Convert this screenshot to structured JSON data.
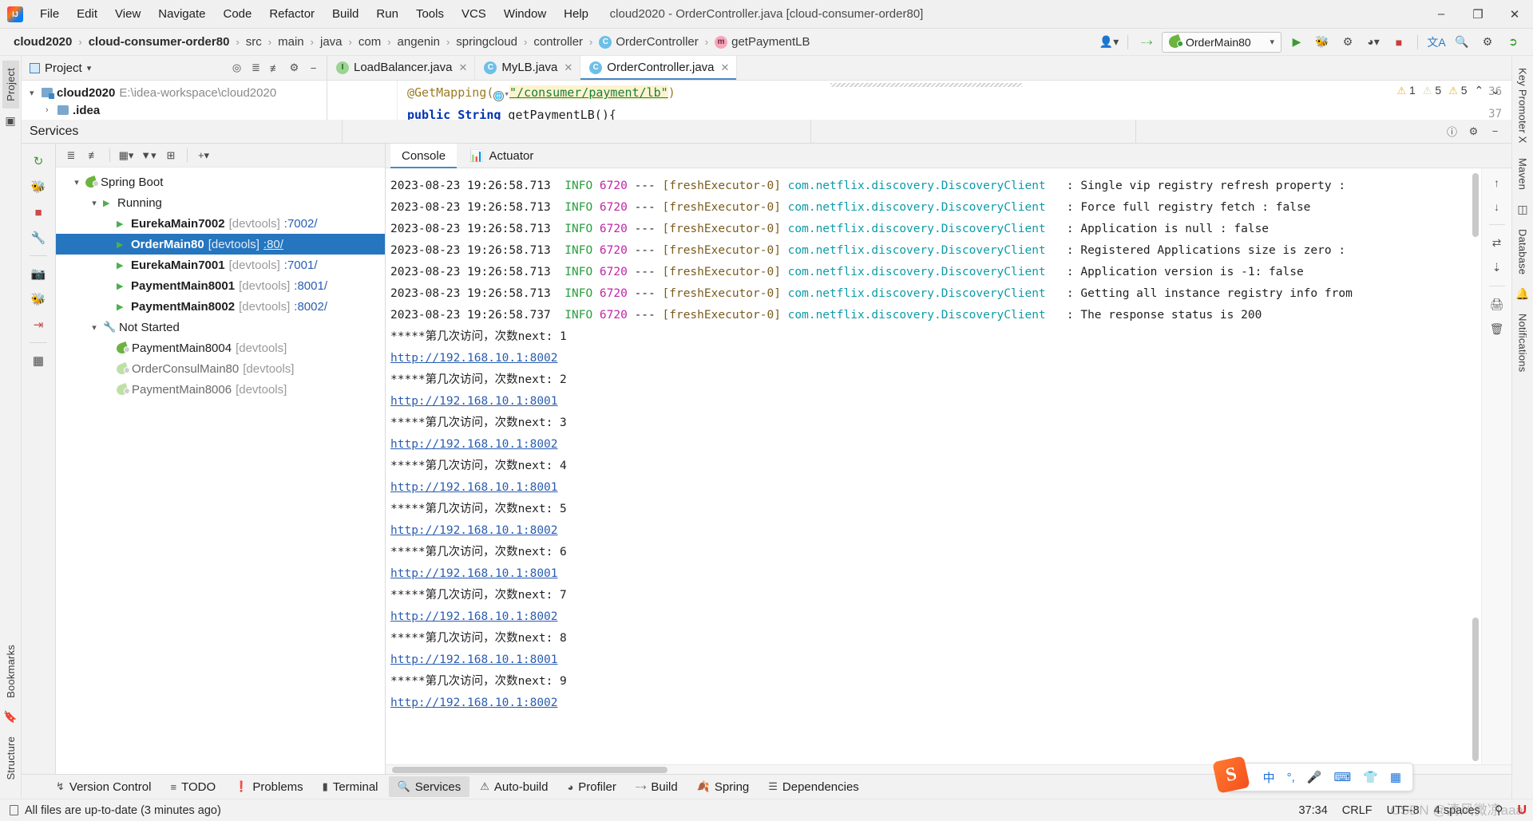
{
  "window": {
    "title": "cloud2020 - OrderController.java [cloud-consumer-order80]",
    "minimize": "–",
    "maximize": "❐",
    "close": "✕"
  },
  "menubar": {
    "items": [
      {
        "label": "File"
      },
      {
        "label": "Edit"
      },
      {
        "label": "View"
      },
      {
        "label": "Navigate"
      },
      {
        "label": "Code"
      },
      {
        "label": "Refactor"
      },
      {
        "label": "Build"
      },
      {
        "label": "Run"
      },
      {
        "label": "Tools"
      },
      {
        "label": "VCS"
      },
      {
        "label": "Window"
      },
      {
        "label": "Help"
      }
    ]
  },
  "breadcrumb": {
    "items": [
      {
        "label": "cloud2020",
        "bold": true
      },
      {
        "label": "cloud-consumer-order80",
        "bold": true
      },
      {
        "label": "src"
      },
      {
        "label": "main"
      },
      {
        "label": "java"
      },
      {
        "label": "com"
      },
      {
        "label": "angenin"
      },
      {
        "label": "springcloud"
      },
      {
        "label": "controller"
      },
      {
        "label": "OrderController",
        "badge": "C"
      },
      {
        "label": "getPaymentLB",
        "badge": "m"
      }
    ],
    "separator": "›"
  },
  "navbar_right": {
    "user_icon": "user-icon",
    "run_config_name": "OrderMain80",
    "run_icon": "▶",
    "debug_icon": "debug-icon",
    "stop_icon": "■",
    "translate_icon": "文A",
    "search_icon": "⌕",
    "settings_icon": "⚙"
  },
  "project_panel": {
    "title": "Project",
    "dropdown": "▾",
    "toolbar_icons": [
      "locate-icon",
      "expand-all-icon",
      "collapse-all-icon",
      "settings-icon",
      "hide-icon"
    ],
    "tree": [
      {
        "label": "cloud2020",
        "path": "E:\\idea-workspace\\cloud2020",
        "expanded": true
      },
      {
        "label": ".idea",
        "path": "",
        "expanded": false
      }
    ]
  },
  "editor_tabs": [
    {
      "label": "LoadBalancer.java",
      "badge": "I",
      "active": false
    },
    {
      "label": "MyLB.java",
      "badge": "C",
      "active": false
    },
    {
      "label": "OrderController.java",
      "badge": "C",
      "active": true
    }
  ],
  "editor": {
    "line_numbers": [
      "36",
      "37"
    ],
    "line36_annotation": "@GetMapping(",
    "line36_string": "\"/consumer/payment/lb\"",
    "line36_close": ")",
    "line37_kw": "public String",
    "line37_rest": " getPaymentLB(){",
    "inspections": [
      {
        "type": "warning",
        "count": "1",
        "dim": false
      },
      {
        "type": "warning",
        "count": "5",
        "dim": true
      },
      {
        "type": "warning",
        "count": "5",
        "dim": false
      }
    ],
    "nav_up": "⌃",
    "nav_down": "⌄"
  },
  "services": {
    "title": "Services",
    "toolbar": {
      "rerun": "rerun-icon",
      "debug": "debug-icon",
      "stop": "stop-icon",
      "settings": "wrench-icon",
      "screenshot": "camera-icon",
      "attach_debug": "attach-debugger-icon",
      "exit": "exit-icon",
      "layout": "layout-icon"
    },
    "tree_toolbar": [
      "expand-icon",
      "collapse-icon",
      "group-icon",
      "filter-icon",
      "add-tab-icon",
      "plus-icon"
    ],
    "tree": [
      {
        "label": "Spring Boot",
        "level": 0,
        "caret": "⌄",
        "icon": "spring",
        "bold": false,
        "suffix": "",
        "port": ""
      },
      {
        "label": "Running",
        "level": 1,
        "caret": "⌄",
        "icon": "play",
        "bold": false,
        "suffix": "",
        "port": ""
      },
      {
        "label": "EurekaMain7002",
        "level": 2,
        "caret": "",
        "icon": "play",
        "bold": true,
        "suffix": "[devtools]",
        "port": ":7002/"
      },
      {
        "label": "OrderMain80",
        "level": 2,
        "caret": "",
        "icon": "play",
        "bold": true,
        "suffix": "[devtools]",
        "port": ":80/",
        "selected": true
      },
      {
        "label": "EurekaMain7001",
        "level": 2,
        "caret": "",
        "icon": "play",
        "bold": true,
        "suffix": "[devtools]",
        "port": ":7001/"
      },
      {
        "label": "PaymentMain8001",
        "level": 2,
        "caret": "",
        "icon": "play",
        "bold": true,
        "suffix": "[devtools]",
        "port": ":8001/"
      },
      {
        "label": "PaymentMain8002",
        "level": 2,
        "caret": "",
        "icon": "play",
        "bold": true,
        "suffix": "[devtools]",
        "port": ":8002/"
      },
      {
        "label": "Not Started",
        "level": 1,
        "caret": "⌄",
        "icon": "wrench",
        "bold": false,
        "suffix": "",
        "port": ""
      },
      {
        "label": "PaymentMain8004",
        "level": 2,
        "caret": "",
        "icon": "spring",
        "bold": false,
        "suffix": "[devtools]",
        "port": ""
      },
      {
        "label": "OrderConsulMain80",
        "level": 2,
        "caret": "",
        "icon": "spring-pale",
        "bold": false,
        "suffix": "[devtools]",
        "port": ""
      },
      {
        "label": "PaymentMain8006",
        "level": 2,
        "caret": "",
        "icon": "spring-pale",
        "bold": false,
        "suffix": "[devtools]",
        "port": ""
      }
    ]
  },
  "console": {
    "tabs": [
      {
        "label": "Console",
        "active": true,
        "icon": ""
      },
      {
        "label": "Actuator",
        "active": false,
        "icon": "actuator-icon"
      }
    ],
    "log_lines": [
      {
        "type": "log",
        "ts": "2023-08-23 19:26:58.713",
        "level": "INFO",
        "pid": "6720",
        "thread": "[freshExecutor-0]",
        "logger": "com.netflix.discovery.DiscoveryClient",
        "msg": ": Single vip registry refresh property :"
      },
      {
        "type": "log",
        "ts": "2023-08-23 19:26:58.713",
        "level": "INFO",
        "pid": "6720",
        "thread": "[freshExecutor-0]",
        "logger": "com.netflix.discovery.DiscoveryClient",
        "msg": ": Force full registry fetch : false"
      },
      {
        "type": "log",
        "ts": "2023-08-23 19:26:58.713",
        "level": "INFO",
        "pid": "6720",
        "thread": "[freshExecutor-0]",
        "logger": "com.netflix.discovery.DiscoveryClient",
        "msg": ": Application is null : false"
      },
      {
        "type": "log",
        "ts": "2023-08-23 19:26:58.713",
        "level": "INFO",
        "pid": "6720",
        "thread": "[freshExecutor-0]",
        "logger": "com.netflix.discovery.DiscoveryClient",
        "msg": ": Registered Applications size is zero :"
      },
      {
        "type": "log",
        "ts": "2023-08-23 19:26:58.713",
        "level": "INFO",
        "pid": "6720",
        "thread": "[freshExecutor-0]",
        "logger": "com.netflix.discovery.DiscoveryClient",
        "msg": ": Application version is -1: false"
      },
      {
        "type": "log",
        "ts": "2023-08-23 19:26:58.713",
        "level": "INFO",
        "pid": "6720",
        "thread": "[freshExecutor-0]",
        "logger": "com.netflix.discovery.DiscoveryClient",
        "msg": ": Getting all instance registry info from"
      },
      {
        "type": "log",
        "ts": "2023-08-23 19:26:58.737",
        "level": "INFO",
        "pid": "6720",
        "thread": "[freshExecutor-0]",
        "logger": "com.netflix.discovery.DiscoveryClient",
        "msg": ": The response status is 200"
      },
      {
        "type": "plain",
        "text": "*****第几次访问，次数next: 1"
      },
      {
        "type": "link",
        "text": "http://192.168.10.1:8002"
      },
      {
        "type": "plain",
        "text": "*****第几次访问，次数next: 2"
      },
      {
        "type": "link",
        "text": "http://192.168.10.1:8001"
      },
      {
        "type": "plain",
        "text": "*****第几次访问，次数next: 3"
      },
      {
        "type": "link",
        "text": "http://192.168.10.1:8002"
      },
      {
        "type": "plain",
        "text": "*****第几次访问，次数next: 4"
      },
      {
        "type": "link",
        "text": "http://192.168.10.1:8001"
      },
      {
        "type": "plain",
        "text": "*****第几次访问，次数next: 5"
      },
      {
        "type": "link",
        "text": "http://192.168.10.1:8002"
      },
      {
        "type": "plain",
        "text": "*****第几次访问，次数next: 6"
      },
      {
        "type": "link",
        "text": "http://192.168.10.1:8001"
      },
      {
        "type": "plain",
        "text": "*****第几次访问，次数next: 7"
      },
      {
        "type": "link",
        "text": "http://192.168.10.1:8002"
      },
      {
        "type": "plain",
        "text": "*****第几次访问，次数next: 8"
      },
      {
        "type": "link",
        "text": "http://192.168.10.1:8001"
      },
      {
        "type": "plain",
        "text": "*****第几次访问，次数next: 9"
      },
      {
        "type": "link",
        "text": "http://192.168.10.1:8002"
      }
    ]
  },
  "left_rail": {
    "tabs": [
      {
        "label": "Project",
        "active": true
      },
      {
        "label": "Bookmarks",
        "active": false
      },
      {
        "label": "Structure",
        "active": false
      }
    ]
  },
  "right_rail": {
    "tabs": [
      {
        "label": "Key Promoter X"
      },
      {
        "label": "Maven"
      },
      {
        "label": "Database"
      },
      {
        "label": "Notifications"
      }
    ]
  },
  "bottom_tabs": [
    {
      "label": "Version Control",
      "icon": "branch-icon",
      "active": false
    },
    {
      "label": "TODO",
      "icon": "list-icon",
      "active": false
    },
    {
      "label": "Problems",
      "icon": "exclamation-icon",
      "active": false
    },
    {
      "label": "Terminal",
      "icon": "terminal-icon",
      "active": false
    },
    {
      "label": "Services",
      "icon": "services-icon",
      "active": true
    },
    {
      "label": "Auto-build",
      "icon": "warning-icon",
      "active": false
    },
    {
      "label": "Profiler",
      "icon": "profiler-icon",
      "active": false
    },
    {
      "label": "Build",
      "icon": "hammer-icon",
      "active": false
    },
    {
      "label": "Spring",
      "icon": "spring-leaf-icon",
      "active": false
    },
    {
      "label": "Dependencies",
      "icon": "dependencies-icon",
      "active": false
    }
  ],
  "statusbar": {
    "message": "All files are up-to-date (3 minutes ago)",
    "caret": "37:34",
    "line_sep": "CRLF",
    "encoding": "UTF-8",
    "indent": "4 spaces",
    "lock": "⚲"
  },
  "ime": {
    "logo": "S",
    "items": [
      "中",
      "°,",
      "mic-icon",
      "keyboard-icon",
      "skin-icon",
      "apps-icon"
    ]
  },
  "watermark": "CSDN @清风微凉aaa"
}
